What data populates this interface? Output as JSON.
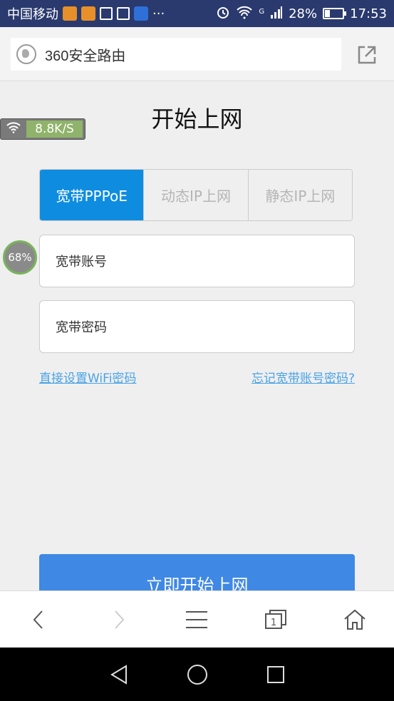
{
  "statusbar": {
    "carrier": "中国移动",
    "more": "···",
    "signal_type": "G",
    "battery_text": "28%",
    "battery_level": 0.28,
    "time": "17:53"
  },
  "addressbar": {
    "url_text": "360安全路由"
  },
  "page": {
    "title": "开始上网",
    "tabs": [
      {
        "label": "宽带PPPoE",
        "active": true
      },
      {
        "label": "动态IP上网",
        "active": false
      },
      {
        "label": "静态IP上网",
        "active": false
      }
    ],
    "account_label": "宽带账号",
    "password_label": "宽带密码",
    "link_wifi": "直接设置WiFi密码",
    "link_forgot": "忘记宽带账号密码?",
    "start_button": "立即开始上网"
  },
  "overlays": {
    "speed_text": "8.8K/S",
    "percent_text": "68%"
  },
  "toolbar": {
    "tabs_count": "1"
  },
  "colors": {
    "statusbar_bg": "#2a3a6e",
    "accent_blue": "#0e8de0",
    "button_blue": "#3f88e4",
    "link_blue": "#4aa3e6"
  }
}
